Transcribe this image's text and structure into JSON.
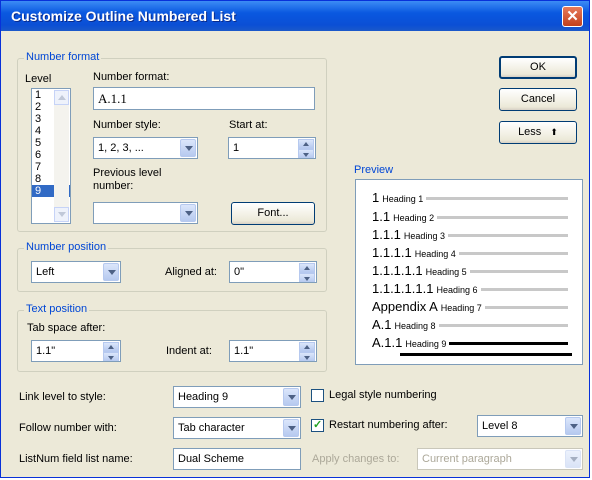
{
  "title": "Customize Outline Numbered List",
  "buttons": {
    "ok": "OK",
    "cancel": "Cancel",
    "less": "Less",
    "less_glyph": "⬆",
    "font": "Font...",
    "close": "✕"
  },
  "number_format": {
    "group_title": "Number format",
    "level_label": "Level",
    "levels": [
      "1",
      "2",
      "3",
      "4",
      "5",
      "6",
      "7",
      "8",
      "9"
    ],
    "selected_level": "9",
    "format_label": "Number format:",
    "format_value": "A.1.1",
    "style_label": "Number style:",
    "style_value": "1, 2, 3, ...",
    "start_label": "Start at:",
    "start_value": "1",
    "prev_label_1": "Previous level",
    "prev_label_2": "number:",
    "prev_value": ""
  },
  "number_position": {
    "group_title": "Number position",
    "align_value": "Left",
    "aligned_at_label": "Aligned at:",
    "aligned_at_value": "0\""
  },
  "text_position": {
    "group_title": "Text position",
    "tab_label": "Tab space after:",
    "tab_value": "1.1\"",
    "indent_label": "Indent at:",
    "indent_value": "1.1\""
  },
  "preview": {
    "label": "Preview",
    "rows": [
      {
        "num": "1",
        "head": "Heading 1"
      },
      {
        "num": "1.1",
        "head": "Heading 2"
      },
      {
        "num": "1.1.1",
        "head": "Heading 3"
      },
      {
        "num": "1.1.1.1",
        "head": "Heading 4"
      },
      {
        "num": "1.1.1.1.1",
        "head": "Heading 5"
      },
      {
        "num": "1.1.1.1.1.1",
        "head": "Heading 6"
      },
      {
        "num": "Appendix A",
        "head": "Heading 7"
      },
      {
        "num": "A.1",
        "head": "Heading 8"
      },
      {
        "num": "A.1.1",
        "head": "Heading 9"
      }
    ]
  },
  "bottom": {
    "link_label": "Link level to style:",
    "link_value": "Heading 9",
    "follow_label": "Follow number with:",
    "follow_value": "Tab character",
    "listnum_label": "ListNum field list name:",
    "listnum_value": "Dual Scheme",
    "legal_label": "Legal style numbering",
    "legal_checked": false,
    "restart_label": "Restart numbering after:",
    "restart_checked": true,
    "restart_value": "Level 8",
    "apply_label": "Apply changes to:",
    "apply_value": "Current paragraph"
  }
}
